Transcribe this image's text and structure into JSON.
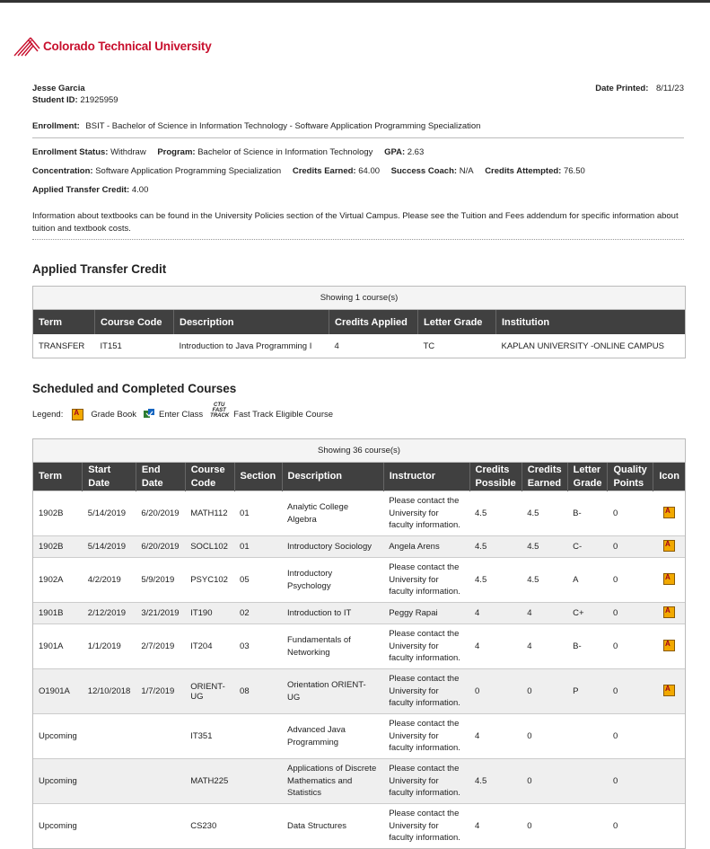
{
  "brand": {
    "name": "Colorado Technical University",
    "color": "#c8102e"
  },
  "student": {
    "name": "Jesse Garcia",
    "id_label": "Student ID:",
    "id": "21925959",
    "date_printed_label": "Date Printed:",
    "date_printed": "8/11/23"
  },
  "enrollment": {
    "label": "Enrollment:",
    "value": "BSIT - Bachelor of Science in Information Technology - Software Application Programming Specialization"
  },
  "status": {
    "status_label": "Enrollment Status:",
    "status": "Withdraw",
    "program_label": "Program:",
    "program": "Bachelor of Science in Information Technology",
    "gpa_label": "GPA:",
    "gpa": "2.63",
    "concentration_label": "Concentration:",
    "concentration": "Software Application Programming Specialization",
    "credits_earned_label": "Credits Earned:",
    "credits_earned": "64.00",
    "coach_label": "Success Coach:",
    "coach": "N/A",
    "credits_attempted_label": "Credits Attempted:",
    "credits_attempted": "76.50",
    "transfer_label": "Applied Transfer Credit:",
    "transfer": "4.00"
  },
  "info_text": "Information about textbooks can be found in the University Policies section of the Virtual Campus. Please see the Tuition and Fees addendum for specific information about tuition and textbook costs.",
  "transfer_section": {
    "title": "Applied Transfer Credit",
    "showing": "Showing 1 course(s)",
    "headers": [
      "Term",
      "Course Code",
      "Description",
      "Credits Applied",
      "Letter Grade",
      "Institution"
    ],
    "rows": [
      [
        "TRANSFER",
        "IT151",
        "Introduction to Java Programming I",
        "4",
        "TC",
        "KAPLAN UNIVERSITY -ONLINE CAMPUS"
      ]
    ]
  },
  "scheduled_section": {
    "title": "Scheduled and Completed Courses",
    "legend": {
      "label": "Legend:",
      "grade_book": "Grade Book",
      "enter_class": "Enter Class",
      "fast_track_icon": "CTU FAST TRACK",
      "fast_track": "Fast Track Eligible Course"
    },
    "showing": "Showing 36 course(s)",
    "headers": {
      "term": "Term",
      "start": "Start Date",
      "end": "End Date",
      "code": "Course Code",
      "section": "Section",
      "desc": "Description",
      "instructor": "Instructor",
      "cp": "Credits Possible",
      "ce": "Credits Earned",
      "lg": "Letter Grade",
      "qp": "Quality Points",
      "icon": "Icon"
    },
    "rows": [
      {
        "term": "1902B",
        "start": "5/14/2019",
        "end": "6/20/2019",
        "code": "MATH112",
        "section": "01",
        "desc": "Analytic College Algebra",
        "instructor": "Please contact the University for faculty information.",
        "cp": "4.5",
        "ce": "4.5",
        "lg": "B-",
        "qp": "0",
        "icon": "grade-book"
      },
      {
        "term": "1902B",
        "start": "5/14/2019",
        "end": "6/20/2019",
        "code": "SOCL102",
        "section": "01",
        "desc": "Introductory Sociology",
        "instructor": "Angela Arens",
        "cp": "4.5",
        "ce": "4.5",
        "lg": "C-",
        "qp": "0",
        "icon": "grade-book"
      },
      {
        "term": "1902A",
        "start": "4/2/2019",
        "end": "5/9/2019",
        "code": "PSYC102",
        "section": "05",
        "desc": "Introductory Psychology",
        "instructor": "Please contact the University for faculty information.",
        "cp": "4.5",
        "ce": "4.5",
        "lg": "A",
        "qp": "0",
        "icon": "grade-book"
      },
      {
        "term": "1901B",
        "start": "2/12/2019",
        "end": "3/21/2019",
        "code": "IT190",
        "section": "02",
        "desc": "Introduction to IT",
        "instructor": "Peggy Rapai",
        "cp": "4",
        "ce": "4",
        "lg": "C+",
        "qp": "0",
        "icon": "grade-book"
      },
      {
        "term": "1901A",
        "start": "1/1/2019",
        "end": "2/7/2019",
        "code": "IT204",
        "section": "03",
        "desc": "Fundamentals of Networking",
        "instructor": "Please contact the University for faculty information.",
        "cp": "4",
        "ce": "4",
        "lg": "B-",
        "qp": "0",
        "icon": "grade-book"
      },
      {
        "term": "O1901A",
        "start": "12/10/2018",
        "end": "1/7/2019",
        "code": "ORIENT-UG",
        "section": "08",
        "desc": "Orientation ORIENT-UG",
        "instructor": "Please contact the University for faculty information.",
        "cp": "0",
        "ce": "0",
        "lg": "P",
        "qp": "0",
        "icon": "grade-book"
      },
      {
        "term": "Upcoming",
        "start": "",
        "end": "",
        "code": "IT351",
        "section": "",
        "desc": "Advanced Java Programming",
        "instructor": "Please contact the University for faculty information.",
        "cp": "4",
        "ce": "0",
        "lg": "",
        "qp": "0",
        "icon": ""
      },
      {
        "term": "Upcoming",
        "start": "",
        "end": "",
        "code": "MATH225",
        "section": "",
        "desc": "Applications of Discrete Mathematics and Statistics",
        "instructor": "Please contact the University for faculty information.",
        "cp": "4.5",
        "ce": "0",
        "lg": "",
        "qp": "0",
        "icon": ""
      },
      {
        "term": "Upcoming",
        "start": "",
        "end": "",
        "code": "CS230",
        "section": "",
        "desc": "Data Structures",
        "instructor": "Please contact the University for faculty information.",
        "cp": "4",
        "ce": "0",
        "lg": "",
        "qp": "0",
        "icon": ""
      }
    ]
  }
}
